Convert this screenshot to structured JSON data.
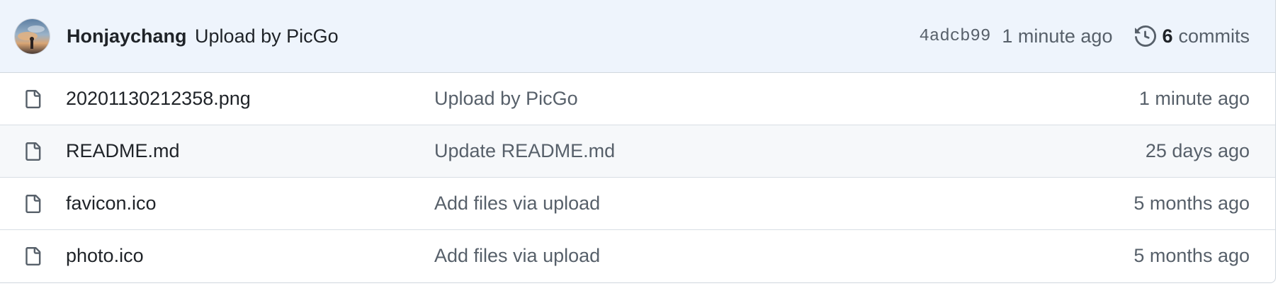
{
  "latest_commit": {
    "author": "Honjaychang",
    "message": "Upload by PicGo",
    "sha": "4adcb99",
    "age": "1 minute ago",
    "commit_count": "6",
    "commits_label": "commits",
    "avatar_icon": "avatar-image",
    "history_icon": "history-icon"
  },
  "files": [
    {
      "name": "20201130212358.png",
      "commit_message": "Upload by PicGo",
      "age": "1 minute ago",
      "icon": "file-icon"
    },
    {
      "name": "README.md",
      "commit_message": "Update README.md",
      "age": "25 days ago",
      "icon": "file-icon"
    },
    {
      "name": "favicon.ico",
      "commit_message": "Add files via upload",
      "age": "5 months ago",
      "icon": "file-icon"
    },
    {
      "name": "photo.ico",
      "commit_message": "Add files via upload",
      "age": "5 months ago",
      "icon": "file-icon"
    }
  ],
  "colors": {
    "header_bg": "#eef4fc",
    "alt_row_bg": "#f6f8fa",
    "border": "#d0d7de",
    "text_primary": "#1f2328",
    "text_muted": "#57606a"
  }
}
